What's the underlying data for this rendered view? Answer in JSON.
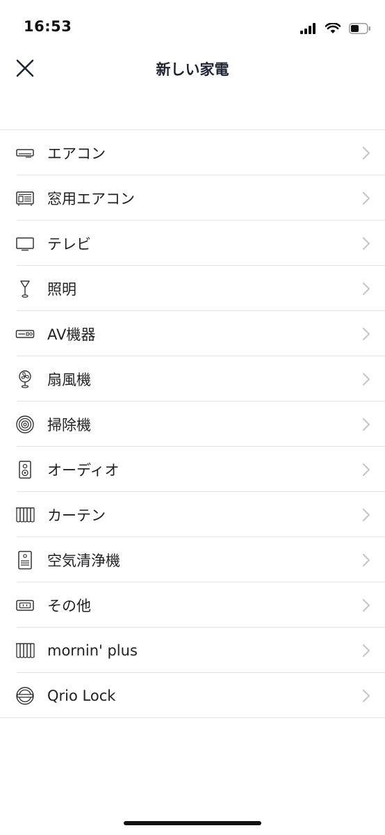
{
  "status_bar": {
    "time": "16:53",
    "icons": [
      "cellular-signal-icon",
      "wifi-icon",
      "battery-icon"
    ]
  },
  "nav": {
    "title": "新しい家電",
    "close_icon": "close-icon"
  },
  "appliances": [
    {
      "label": "エアコン",
      "icon": "air-conditioner-icon"
    },
    {
      "label": "窓用エアコン",
      "icon": "window-air-conditioner-icon"
    },
    {
      "label": "テレビ",
      "icon": "tv-icon"
    },
    {
      "label": "照明",
      "icon": "light-icon"
    },
    {
      "label": "AV機器",
      "icon": "av-device-icon"
    },
    {
      "label": "扇風機",
      "icon": "fan-icon"
    },
    {
      "label": "掃除機",
      "icon": "robot-vacuum-icon"
    },
    {
      "label": "オーディオ",
      "icon": "speaker-icon"
    },
    {
      "label": "カーテン",
      "icon": "curtain-icon"
    },
    {
      "label": "空気清浄機",
      "icon": "air-purifier-icon"
    },
    {
      "label": "その他",
      "icon": "other-device-icon"
    },
    {
      "label": "mornin' plus",
      "icon": "mornin-plus-icon"
    },
    {
      "label": "Qrio Lock",
      "icon": "qrio-lock-icon"
    }
  ],
  "colors": {
    "text": "#1f1f24",
    "separator": "#e3e3e6",
    "chevron": "#c7c7cc",
    "background": "#ffffff"
  }
}
